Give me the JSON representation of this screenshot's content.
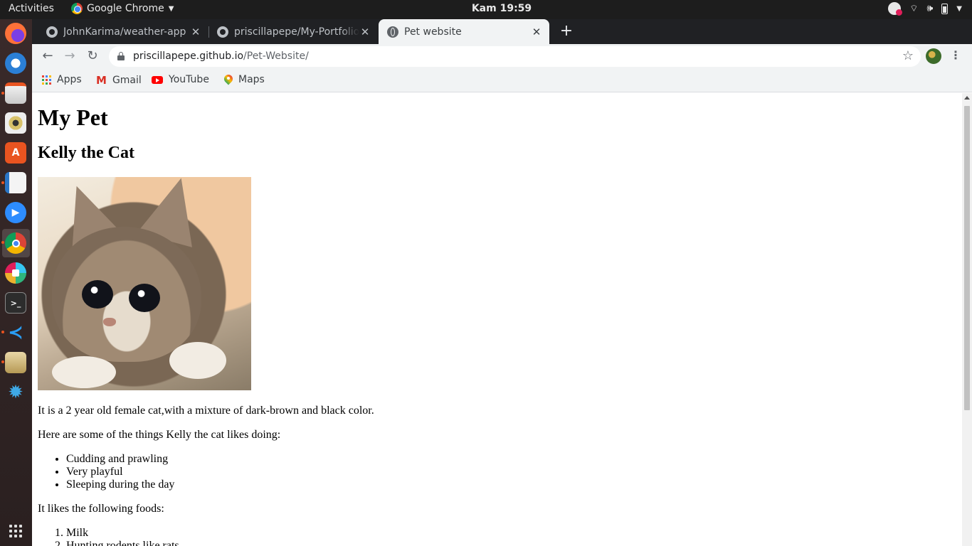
{
  "topbar": {
    "activities": "Activities",
    "app_name": "Google Chrome",
    "clock": "Kam 19:59",
    "tray_icons": [
      "slack-status-icon",
      "wifi-icon",
      "volume-icon",
      "battery-icon",
      "chevron-down-icon"
    ]
  },
  "dock": {
    "items": [
      "firefox",
      "thunderbird",
      "files",
      "rhythmbox",
      "software",
      "libreoffice-writer",
      "zoom",
      "chrome",
      "slack",
      "terminal",
      "vscode",
      "image-viewer",
      "settings",
      "show-apps"
    ]
  },
  "tabs": [
    {
      "title": "JohnKarima/weather-app",
      "icon": "github-icon",
      "active": false
    },
    {
      "title": "priscillapepe/My-Portfolio",
      "icon": "github-icon",
      "active": false
    },
    {
      "title": "Pet website",
      "icon": "globe-icon",
      "active": true
    }
  ],
  "omnibox": {
    "host": "priscillapepe.github.io",
    "path": "/Pet-Website/"
  },
  "bookmarks": [
    {
      "label": "Apps",
      "icon": "apps-grid-icon"
    },
    {
      "label": "Gmail",
      "icon": "gmail-icon"
    },
    {
      "label": "YouTube",
      "icon": "youtube-icon"
    },
    {
      "label": "Maps",
      "icon": "maps-icon"
    }
  ],
  "page": {
    "h1": "My Pet",
    "h2": "Kelly the Cat",
    "image_alt": "kitten photo",
    "description": "It is a 2 year old female cat,with a mixture of dark-brown and black color.",
    "likes_intro": "Here are some of the things Kelly the cat likes doing:",
    "likes": [
      "Cudding and prawling",
      "Very playful",
      "Sleeping during the day"
    ],
    "foods_intro": "It likes the following foods:",
    "foods": [
      "Milk",
      "Hunting rodents like rats"
    ]
  },
  "colors": {
    "tabstrip": "#202124",
    "toolbar": "#f1f3f4",
    "dock_accent": "#e95420"
  }
}
